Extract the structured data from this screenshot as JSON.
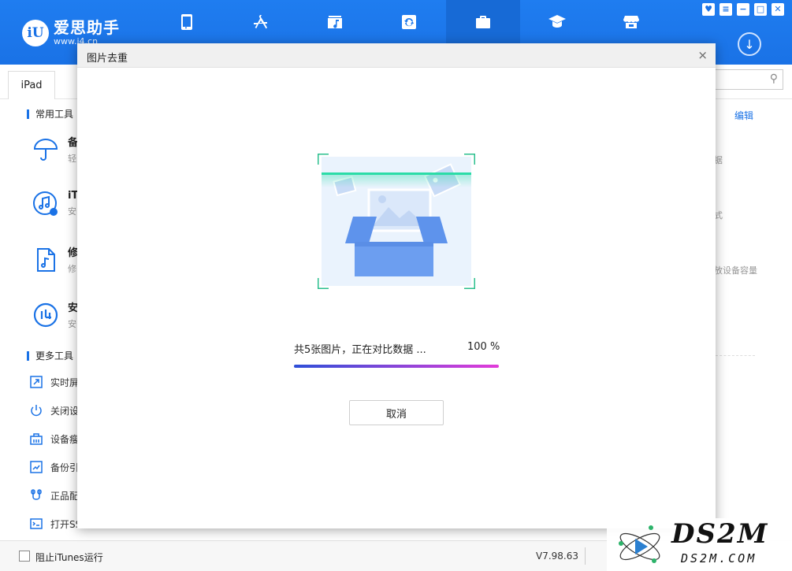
{
  "app": {
    "logo_badge": "iU",
    "logo_name": "爱思助手",
    "logo_url": "www.i4.cn"
  },
  "nav": {
    "items": [
      {
        "icon": "phone-icon"
      },
      {
        "icon": "app-store-icon"
      },
      {
        "icon": "music-folder-icon"
      },
      {
        "icon": "sync-icon"
      },
      {
        "icon": "toolbox-icon"
      },
      {
        "icon": "graduation-cap-icon"
      },
      {
        "icon": "store-icon"
      }
    ],
    "active_index": 4
  },
  "window": {
    "skin_btn": "♥",
    "menu_btn": "≡",
    "min_btn": "−",
    "max_btn": "□",
    "close_btn": "✕",
    "download_icon": "↓"
  },
  "tabs": {
    "device_tab": "iPad",
    "search_icon": "⚲"
  },
  "sidebar": {
    "common_tools_title": "常用工具",
    "common_tools": [
      {
        "name": "备",
        "desc": "轻"
      },
      {
        "name": "iT",
        "desc": "安"
      },
      {
        "name": "修",
        "desc": "修"
      },
      {
        "name": "安",
        "desc": "安"
      }
    ],
    "more_tools_title": "更多工具",
    "more_tools": [
      {
        "label": "实时屏"
      },
      {
        "label": "关闭设"
      },
      {
        "label": "设备瘦"
      },
      {
        "label": "备份引"
      },
      {
        "label": "正品配"
      },
      {
        "label": "打开SS"
      }
    ]
  },
  "right_panel": {
    "edit_link": "编辑",
    "frag1": "据",
    "frag2": "式",
    "frag3": "放设备容量"
  },
  "bottom": {
    "itunes_label": "阻止iTunes运行",
    "version": "V7.98.63"
  },
  "modal": {
    "title": "图片去重",
    "close": "×",
    "progress_text": "共5张图片，正在对比数据 ...",
    "progress_percent_label": "100 %",
    "progress_value": 100,
    "cancel_label": "取消"
  },
  "watermark": {
    "main": "DS2M",
    "sub": "DS2M.COM"
  },
  "colors": {
    "brand_blue": "#1a72e6",
    "scan_green": "#2bdca7",
    "progress_start": "#2e4fd8",
    "progress_end": "#e23bd9"
  }
}
